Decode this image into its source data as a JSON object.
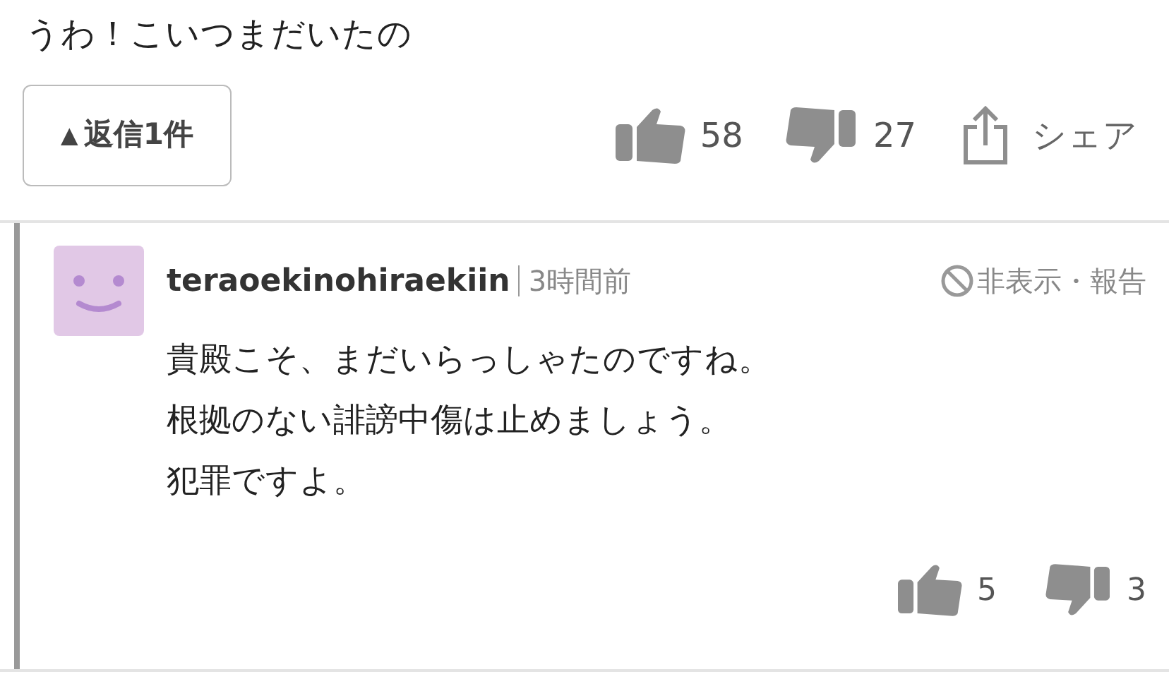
{
  "comment": {
    "text": "うわ！こいつまだいたの",
    "replies_button": {
      "arrow": "▲",
      "label": "返信1件"
    },
    "likes": "58",
    "dislikes": "27",
    "share": "シェア"
  },
  "reply": {
    "author": "teraoekinohiraekiin",
    "time": "3時間前",
    "hide_report": "非表示・報告",
    "lines": [
      "貴殿こそ、まだいらっしゃたのですね。",
      "根拠のない誹謗中傷は止めましょう。",
      "犯罪ですよ。"
    ],
    "likes": "5",
    "dislikes": "3"
  }
}
